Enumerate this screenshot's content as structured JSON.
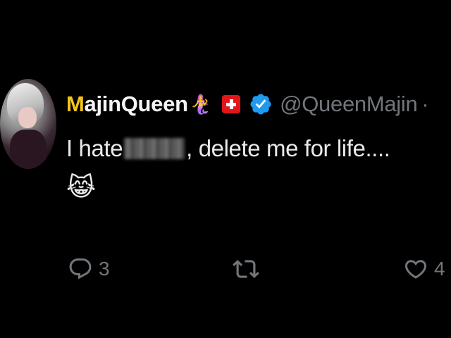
{
  "tweet": {
    "display_name_first": "M",
    "display_name_rest": "ajinQueen",
    "name_emoji": "🧜‍♀️",
    "handle": "@QueenMajin",
    "separator": "·",
    "text_before": "I hate ",
    "text_after": ", delete me for life....",
    "emoji_line": "😹"
  },
  "actions": {
    "reply_count": "3",
    "retweet_count": "",
    "like_count": "4"
  },
  "colors": {
    "background": "#000000",
    "text": "#e7e9ea",
    "secondary": "#71767b",
    "verified": "#1d9bf0",
    "flag_red": "#e4141b",
    "name_accent": "#f5c518"
  },
  "icons": [
    "swiss-flag-icon",
    "verified-badge-icon",
    "reply-icon",
    "retweet-icon",
    "like-icon"
  ]
}
